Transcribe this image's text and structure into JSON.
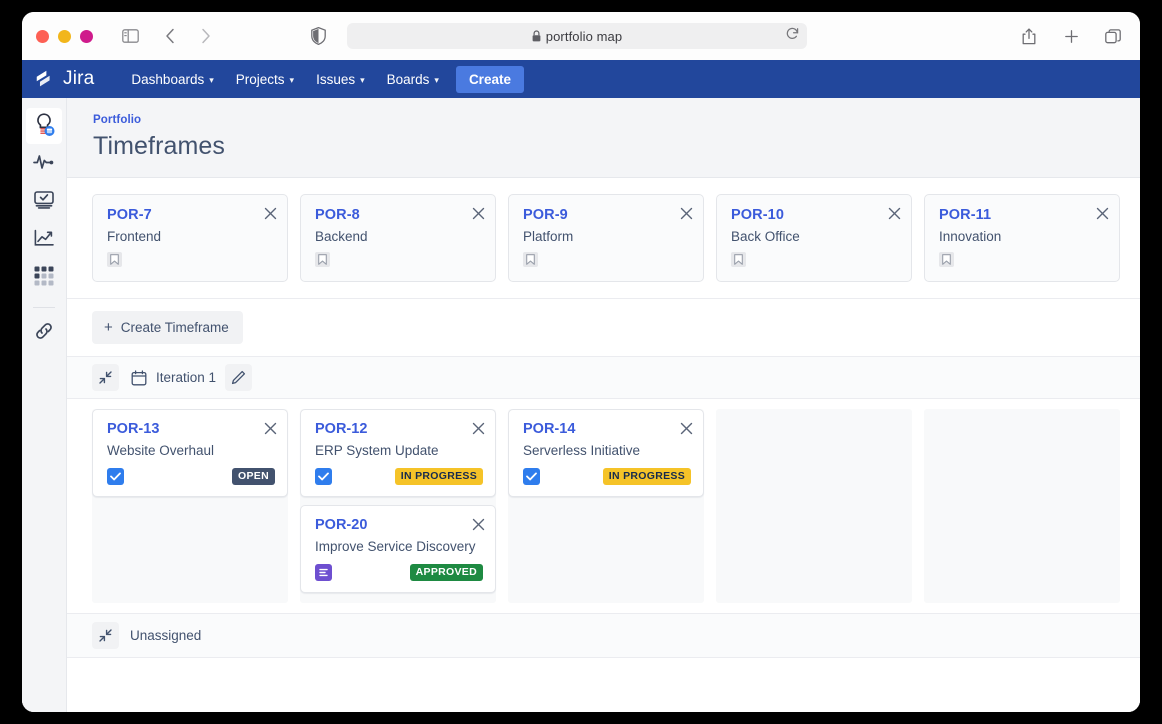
{
  "browser": {
    "url": "portfolio map",
    "lock_icon": "lock-icon",
    "reload_icon": "reload-icon",
    "sidebar_toggle_icon": "sidebar-toggle-icon",
    "back_icon": "back-arrow-icon",
    "forward_icon": "forward-arrow-icon",
    "shield_icon": "privacy-shield-icon",
    "share_icon": "share-icon",
    "newtab_icon": "plus-icon",
    "tabs_icon": "tab-overview-icon",
    "traffic_lights": [
      "#fd6054",
      "#f2b61b",
      "#cf1b8c"
    ]
  },
  "topnav": {
    "logo_text": "Jira",
    "items": [
      {
        "label": "Dashboards",
        "caret": "⌄"
      },
      {
        "label": "Projects",
        "caret": "⌄"
      },
      {
        "label": "Issues",
        "caret": "⌄"
      },
      {
        "label": "Boards",
        "caret": "⌄"
      }
    ],
    "create_label": "Create",
    "bg_color": "#22479c",
    "create_color": "#4a7ae0"
  },
  "rail": {
    "items": [
      {
        "name": "idea-lightbulb-icon",
        "active": true
      },
      {
        "name": "activity-pulse-icon",
        "active": false
      },
      {
        "name": "monitor-icon",
        "active": false
      },
      {
        "name": "reports-chart-icon",
        "active": false
      },
      {
        "name": "apps-grid-icon",
        "active": false
      },
      {
        "name": "link-icon",
        "active": false
      }
    ]
  },
  "page": {
    "breadcrumb": "Portfolio",
    "title": "Timeframes"
  },
  "timeframes": [
    {
      "key": "POR-7",
      "name": "Frontend",
      "type_icon": "epic-bookmark-icon",
      "close_icon": "close-icon"
    },
    {
      "key": "POR-8",
      "name": "Backend",
      "type_icon": "epic-bookmark-icon",
      "close_icon": "close-icon"
    },
    {
      "key": "POR-9",
      "name": "Platform",
      "type_icon": "epic-bookmark-icon",
      "close_icon": "close-icon"
    },
    {
      "key": "POR-10",
      "name": "Back Office",
      "type_icon": "epic-bookmark-icon",
      "close_icon": "close-icon"
    },
    {
      "key": "POR-11",
      "name": "Innovation",
      "type_icon": "epic-bookmark-icon",
      "close_icon": "close-icon"
    }
  ],
  "create_timeframe": {
    "plus": "+",
    "label": "Create Timeframe"
  },
  "rows": [
    {
      "id": "iteration-1",
      "label": "Iteration 1",
      "collapse_icon": "collapse-icon",
      "calendar_icon": "calendar-icon",
      "edit_icon": "pencil-edit-icon",
      "columns": [
        {
          "cards": [
            {
              "key": "POR-13",
              "summary": "Website Overhaul",
              "type": "task",
              "type_icon": "task-checkbox-icon",
              "status": "OPEN",
              "status_style": "open",
              "close_icon": "close-icon"
            }
          ]
        },
        {
          "cards": [
            {
              "key": "POR-12",
              "summary": "ERP System Update",
              "type": "task",
              "type_icon": "task-checkbox-icon",
              "status": "IN PROGRESS",
              "status_style": "progress",
              "close_icon": "close-icon"
            },
            {
              "key": "POR-20",
              "summary": "Improve Service Discovery",
              "type": "story",
              "type_icon": "story-document-icon",
              "status": "APPROVED",
              "status_style": "approved",
              "close_icon": "close-icon"
            }
          ]
        },
        {
          "cards": [
            {
              "key": "POR-14",
              "summary": "Serverless Initiative",
              "type": "task",
              "type_icon": "task-checkbox-icon",
              "status": "IN PROGRESS",
              "status_style": "progress",
              "close_icon": "close-icon"
            }
          ]
        },
        {
          "cards": []
        },
        {
          "cards": []
        }
      ]
    }
  ],
  "unassigned": {
    "label": "Unassigned",
    "collapse_icon": "collapse-icon"
  },
  "colors": {
    "brand_blue": "#22479c",
    "link_blue": "#3b5bdb",
    "text": "#42526e",
    "open_badge": "#42526e",
    "progress_badge": "#f5c328",
    "approved_badge": "#1e8a42"
  }
}
